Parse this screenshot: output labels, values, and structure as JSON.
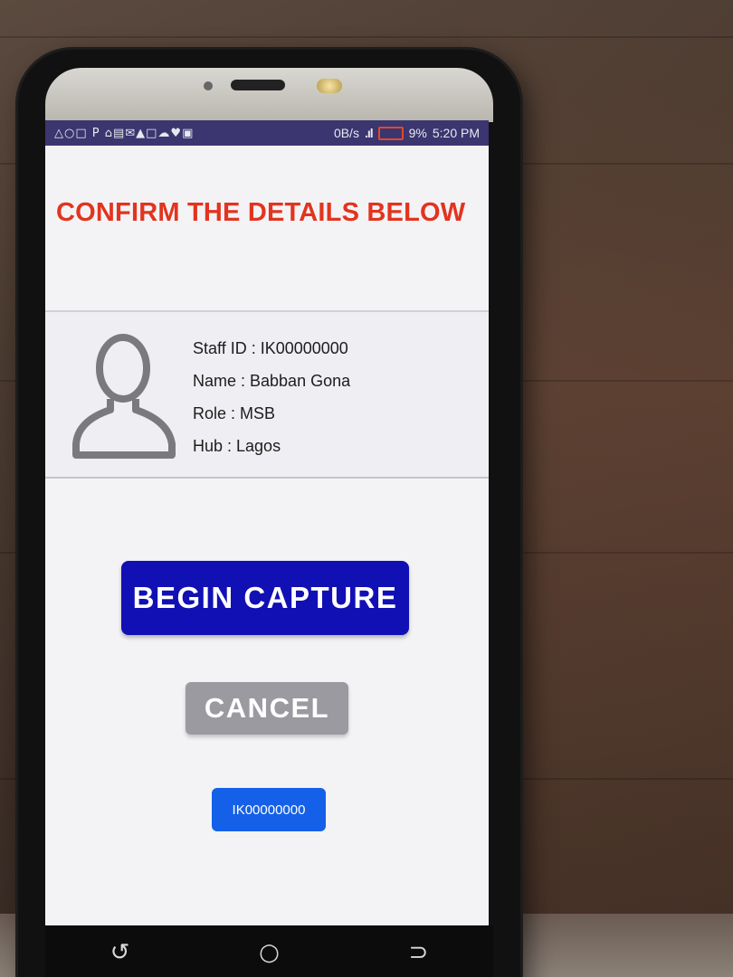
{
  "statusbar": {
    "notification_icons": "△○□ P ⌂▤✉▲□☁♥▣",
    "net_speed": "0B/s",
    "signal": ".ıl",
    "battery": "9%",
    "time": "5:20 PM",
    "battery_color": "#e04a2a"
  },
  "screen": {
    "heading": "CONFIRM THE DETAILS BELOW",
    "heading_color": "#e2341e",
    "details": {
      "staff_id": "Staff ID : IK00000000",
      "name": "Name : Babban Gona",
      "role": "Role : MSB",
      "hub": "Hub : Lagos"
    },
    "begin_button": "BEGIN CAPTURE",
    "begin_button_color": "#1110b5",
    "cancel_button": "CANCEL",
    "cancel_button_color": "#9a9aa0",
    "id_button": "IK00000000",
    "id_button_color": "#1560e8"
  },
  "navbar": {
    "back_icon": "back-icon",
    "home_icon": "home-icon",
    "recents_icon": "recents-icon"
  }
}
